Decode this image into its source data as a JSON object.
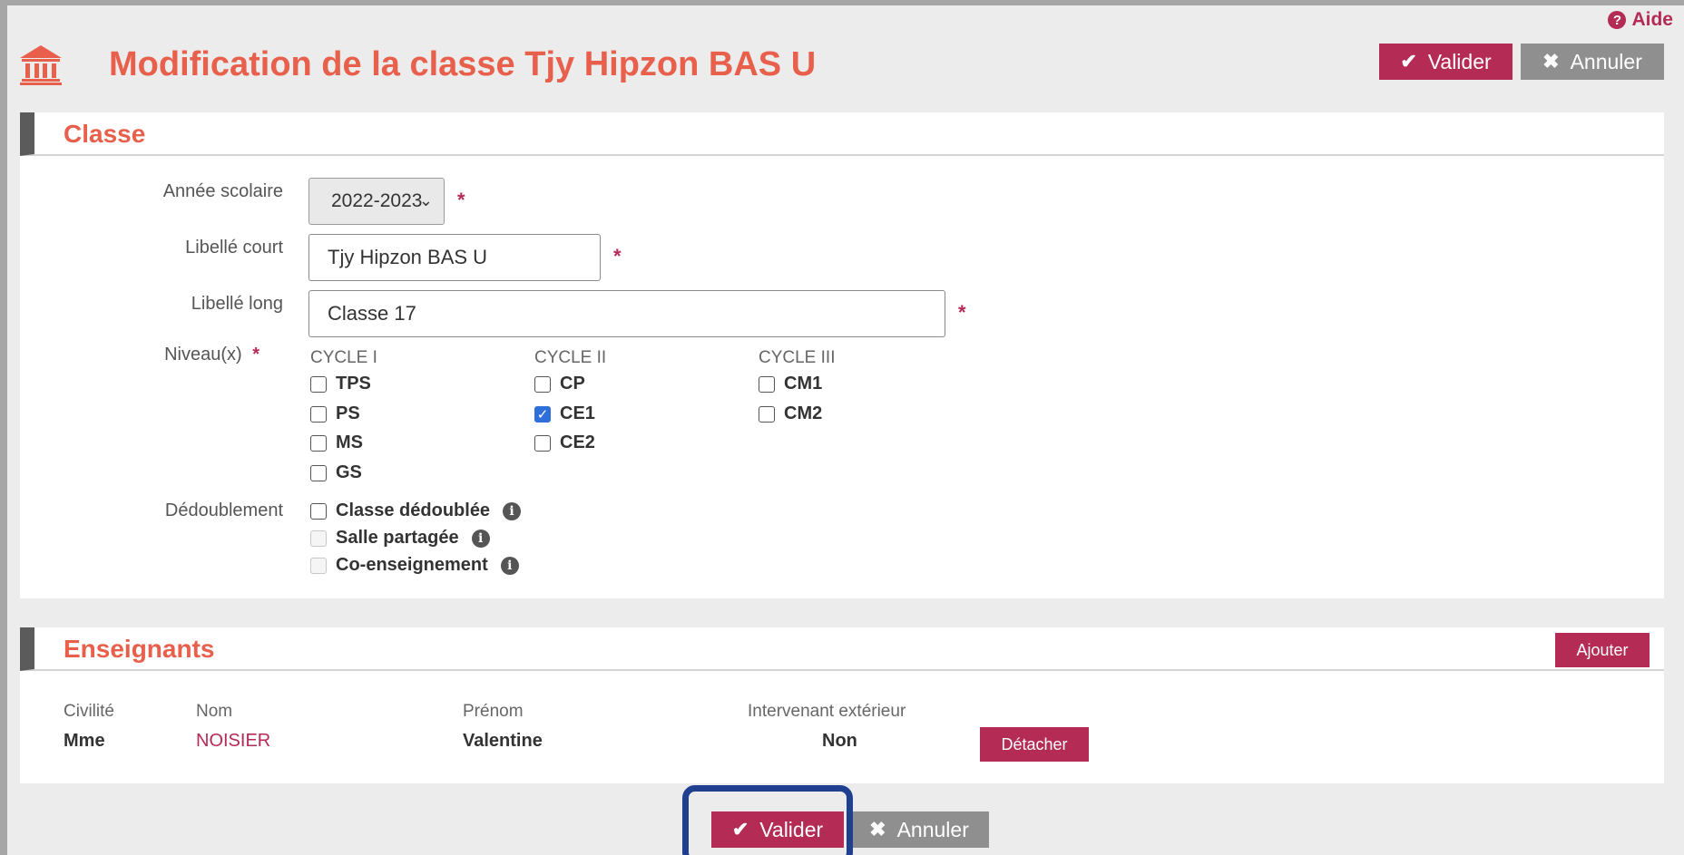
{
  "header": {
    "help_label": "Aide",
    "title": "Modification de la classe Tjy Hipzon BAS U",
    "valider_label": "Valider",
    "annuler_label": "Annuler"
  },
  "classe": {
    "section_title": "Classe",
    "annee_label": "Année scolaire",
    "annee_value": "2022-2023",
    "libelle_court_label": "Libellé court",
    "libelle_court_value": "Tjy Hipzon BAS U",
    "libelle_long_label": "Libellé long",
    "libelle_long_value": "Classe 17",
    "niveaux_label": "Niveau(x)",
    "required_mark": "*",
    "cycles": [
      {
        "title": "CYCLE I",
        "levels": [
          {
            "label": "TPS",
            "checked": false
          },
          {
            "label": "PS",
            "checked": false
          },
          {
            "label": "MS",
            "checked": false
          },
          {
            "label": "GS",
            "checked": false
          }
        ]
      },
      {
        "title": "CYCLE II",
        "levels": [
          {
            "label": "CP",
            "checked": false
          },
          {
            "label": "CE1",
            "checked": true
          },
          {
            "label": "CE2",
            "checked": false
          }
        ]
      },
      {
        "title": "CYCLE III",
        "levels": [
          {
            "label": "CM1",
            "checked": false
          },
          {
            "label": "CM2",
            "checked": false
          }
        ]
      }
    ],
    "dedoublement_label": "Dédoublement",
    "dedoublement_options": [
      {
        "label": "Classe dédoublée",
        "disabled": false
      },
      {
        "label": "Salle partagée",
        "disabled": true
      },
      {
        "label": "Co-enseignement",
        "disabled": true
      }
    ]
  },
  "enseignants": {
    "section_title": "Enseignants",
    "ajouter_label": "Ajouter",
    "columns": [
      "Civilité",
      "Nom",
      "Prénom",
      "Intervenant extérieur"
    ],
    "rows": [
      {
        "civilite": "Mme",
        "nom": "NOISIER",
        "prenom": "Valentine",
        "intervenant": "Non",
        "action_label": "Détacher"
      }
    ]
  },
  "footer": {
    "valider_label": "Valider",
    "annuler_label": "Annuler"
  },
  "colors": {
    "accent": "#b42b55",
    "title": "#e8604c",
    "highlight": "#1f3f8f"
  }
}
